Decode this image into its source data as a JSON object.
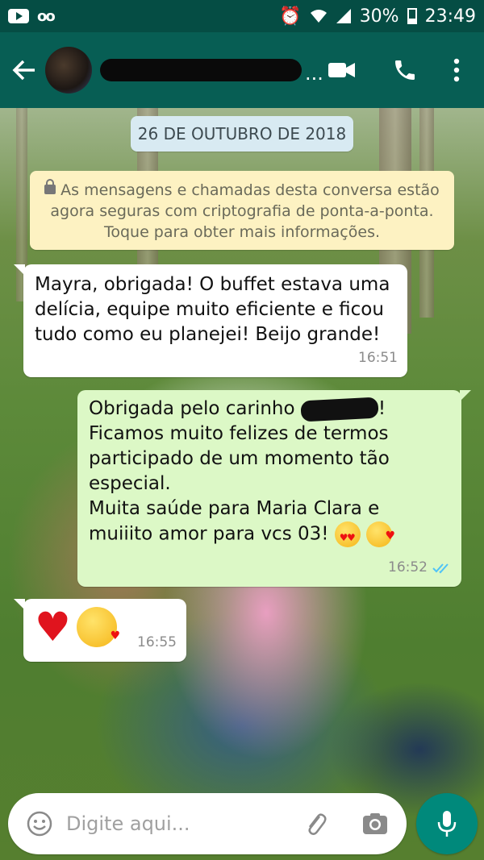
{
  "status_bar": {
    "battery": "30%",
    "time": "23:49"
  },
  "header": {
    "contact_name": "",
    "ellipsis": "...",
    "icons": [
      "back-arrow-icon",
      "video-call-icon",
      "phone-icon",
      "more-vert-icon"
    ]
  },
  "date_label": "26 DE OUTUBRO DE 2018",
  "encryption_notice": {
    "line1": "As mensagens e chamadas desta conversa estão",
    "line2": "agora seguras com criptografia de ponta-a-ponta.",
    "line3": "Toque para obter mais informações."
  },
  "messages": [
    {
      "direction": "incoming",
      "text": "Mayra, obrigada! O buffet estava uma\ndelícia, equipe muito eficiente e ficou\ntudo como eu planejei! Beijo grande!",
      "time": "16:51"
    },
    {
      "direction": "outgoing",
      "line1": "Obrigada pelo carinho ",
      "line1_end": "!",
      "body": "Ficamos muito felizes de termos\nparticipado de um momento tão\nespecial.\nMuita saúde para Maria Clara e",
      "last_line": "muiiito amor para vcs 03! ",
      "time": "16:52",
      "status": "read"
    },
    {
      "direction": "incoming",
      "emojis": [
        "red-heart",
        "kissing-face-with-heart"
      ],
      "time": "16:55"
    }
  ],
  "composer": {
    "placeholder": "Digite aqui..."
  },
  "colors": {
    "status_bar": "#054d44",
    "toolbar": "#075e54",
    "outgoing_bubble": "#dcf8c6",
    "incoming_bubble": "#ffffff",
    "notice": "#fdf2c2",
    "date_pill": "#d8eaf2",
    "mic_button": "#00897b",
    "read_ticks": "#4fc3f7"
  }
}
